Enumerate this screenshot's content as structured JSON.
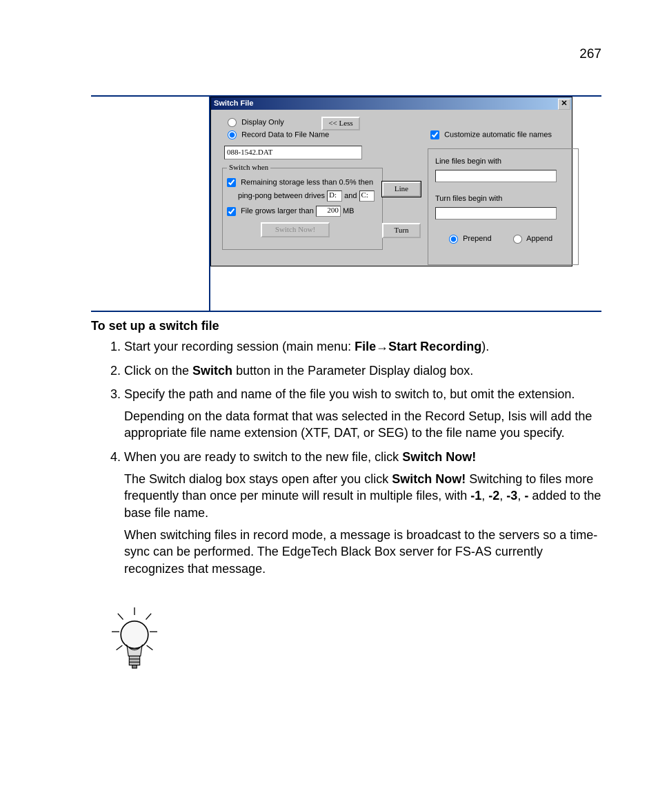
{
  "page": {
    "number": "267"
  },
  "dialog": {
    "title": "Switch File",
    "close": "✕",
    "display_only": "Display Only",
    "record_data": "Record Data to File Name",
    "less_btn": "<< Less",
    "filename": "088-1542.DAT",
    "switch_legend": "Switch when",
    "remaining": "Remaining storage less than 0.5% then",
    "pingpong_a": "ping-pong between drives",
    "drive1": "D:",
    "pingpong_b": "and",
    "drive2": "C:",
    "grows_a": "File grows larger than",
    "size": "200",
    "grows_b": "MB",
    "switch_now": "Switch Now!",
    "line_btn": "Line",
    "turn_btn": "Turn",
    "customize": "Customize automatic file names",
    "line_label": "Line files begin with",
    "turn_label": "Turn files begin with",
    "prepend": "Prepend",
    "append": "Append"
  },
  "doc": {
    "heading": "To set up a switch file",
    "s1_a": "Start your recording session (main menu: ",
    "s1_b": "File",
    "s1_arrow": "→",
    "s1_c": "Start Recording",
    "s1_d": ").",
    "s2_a": "Click on the ",
    "s2_b": "Switch",
    "s2_c": " button in the Parameter Display dialog box.",
    "s3": "Specify the path and name of the file you wish to switch to, but omit the extension.",
    "s3p": "Depending on the data format that was selected in the Record Setup, Isis will add the appropriate file name extension (XTF, DAT, or SEG) to the file name you specify.",
    "s4_a": "When you are ready to switch to the new file, click ",
    "s4_b": "Switch Now!",
    "s4p_a": "The Switch dialog box stays open after you click ",
    "s4p_b": "Switch Now!",
    "s4p_c": " Switching to files more frequently than once per minute will result in multiple files, with ",
    "s4p_d1": "-1",
    "s4p_d2": "-2",
    "s4p_d3": "-3",
    "s4p_d4": "-",
    "s4p_e": " added to the base file name.",
    "note": "When switching files in record mode, a message is broadcast to the servers so a time-sync can be performed. The EdgeTech Black Box server for FS-AS currently recognizes that message."
  }
}
